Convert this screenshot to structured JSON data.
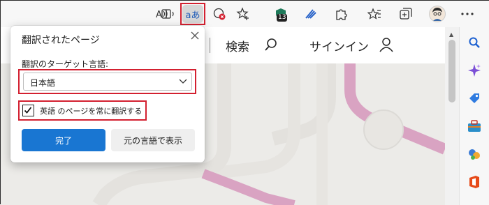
{
  "toolbar": {
    "read_aloud_icon": "read-aloud-icon",
    "immersive_reader_icon": "immersive-reader-icon",
    "translate_label": "aあ",
    "tracking_icon": "tracking-prevention-icon",
    "favorite_add_icon": "star-plus-icon",
    "extension_badge_count": "13",
    "accent_color": "#d32030"
  },
  "site": {
    "search_label": "検索",
    "signin_label": "サインイン"
  },
  "popup": {
    "title": "翻訳されたページ",
    "target_language_label": "翻訳のターゲット言語:",
    "target_language_value": "日本語",
    "always_translate_label": "英語 のページを常に翻訳する",
    "always_translate_checked": true,
    "done_button": "完了",
    "show_original_button": "元の言語で表示",
    "primary_color": "#1976d2"
  },
  "sidebar": {
    "icons": [
      "search-icon",
      "sparkle-icon",
      "tag-icon",
      "toolbox-icon",
      "games-icon",
      "office-icon",
      "add-icon"
    ]
  }
}
